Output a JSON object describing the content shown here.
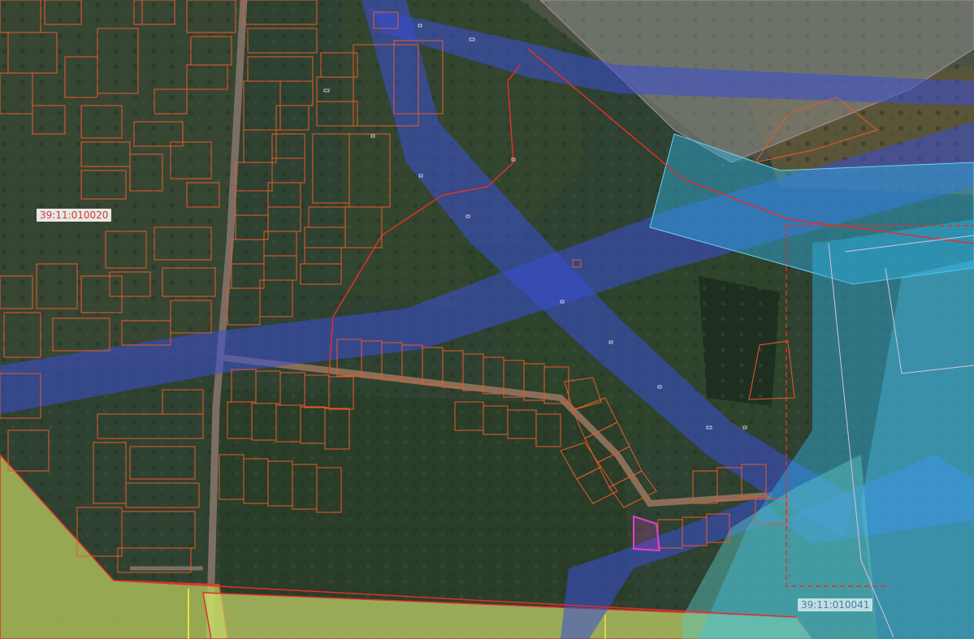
{
  "map": {
    "cadastral_labels": [
      {
        "id": "quarter-west",
        "text": "39:11:010020"
      },
      {
        "id": "quarter-east",
        "text": "39:11:010041"
      }
    ],
    "layers": {
      "imagery": "satellite",
      "parcel_boundaries_color": "#e85a2a",
      "quarter_boundary_color": "#e0302a",
      "utility_corridor_color": "#3b4fd6",
      "protection_zone_color": "#2fb3e6",
      "agricultural_zone_color": "#c7d96a",
      "selected_parcel_color": "#e43cd6"
    }
  }
}
